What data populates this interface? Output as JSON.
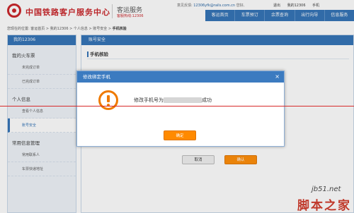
{
  "header": {
    "site_title": "中国铁路客户服务中心",
    "sub_title": "客运服务",
    "hotline": "客服热线:12306",
    "feedback_label": "意见反馈:",
    "feedback_email": "12306yfk@rails.com.cn",
    "greeting": "您好,",
    "logout": "退出",
    "my12306": "我的12306",
    "mobile": "手机"
  },
  "nav": [
    "客运首页",
    "车票预订",
    "余票查询",
    "出行向导",
    "信息服务"
  ],
  "breadcrumb": {
    "prefix": "您现在的位置: 客运首页 > 我的12306 > 个人信息 > 账号安全 > ",
    "current": "手机核验"
  },
  "sidebar": {
    "title": "我的12306",
    "groups": [
      {
        "label": "我的火车票",
        "items": [
          "未完成订单",
          "已完成订单"
        ]
      },
      {
        "label": "个人信息",
        "items": [
          "查看个人信息",
          "账号安全"
        ]
      },
      {
        "label": "常用信息管理",
        "items": [
          "常用联系人",
          "车票快递地址"
        ]
      }
    ]
  },
  "main": {
    "section_title": "账号安全",
    "sub_title": "手机核验",
    "cancel": "取消",
    "confirm": "确认"
  },
  "dialog": {
    "title": "修改绑定手机",
    "close": "×",
    "msg_prefix": "修改手机号为",
    "msg_suffix": "成功",
    "ok": "确定"
  },
  "watermark": {
    "line1": "jb51.net",
    "line2": "脚本之家"
  }
}
